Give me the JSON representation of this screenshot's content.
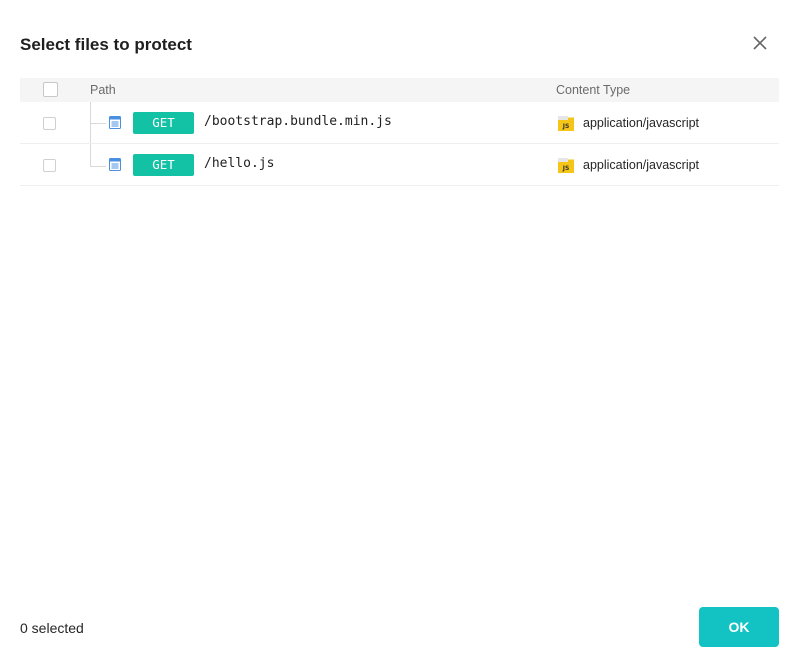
{
  "dialog": {
    "title": "Select files to protect"
  },
  "table": {
    "columns": {
      "path": "Path",
      "content_type": "Content Type"
    },
    "rows": [
      {
        "method": "GET",
        "path": "/bootstrap.bundle.min.js",
        "content_type": "application/javascript",
        "checked": false
      },
      {
        "method": "GET",
        "path": "/hello.js",
        "content_type": "application/javascript",
        "checked": false
      }
    ]
  },
  "footer": {
    "selected_text": "0 selected",
    "ok_label": "OK"
  },
  "icons": {
    "close": "close-icon",
    "file": "file-icon",
    "js": "js-file-icon"
  },
  "colors": {
    "method_badge": "#13c2a5",
    "ok_button": "#13c2c2",
    "file_icon": "#4a90e2",
    "js_icon": "#f5c518"
  }
}
